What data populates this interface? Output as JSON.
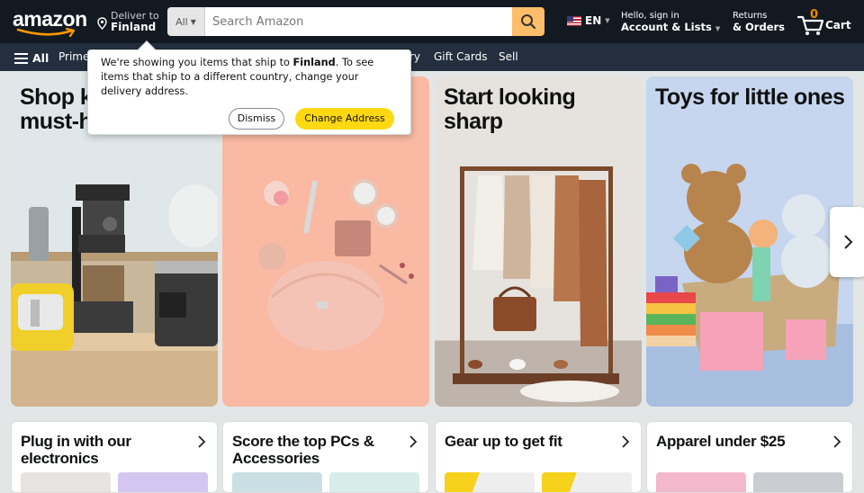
{
  "header": {
    "logo_text": "amazon",
    "deliver_line1": "Deliver to",
    "deliver_line2": "Finland",
    "search_category": "All",
    "search_placeholder": "Search Amazon",
    "language": "EN",
    "account_line1": "Hello, sign in",
    "account_line2": "Account & Lists",
    "returns_line1": "Returns",
    "returns_line2": "& Orders",
    "cart_count": "0",
    "cart_label": "Cart"
  },
  "nav": {
    "all": "All",
    "items": [
      "Prime",
      "ry",
      "Gift Cards",
      "Sell"
    ]
  },
  "popover": {
    "msg_before": "We're showing you items that ship to ",
    "msg_bold": "Finland",
    "msg_after": ". To see items that ship to a different country, change your delivery address.",
    "dismiss": "Dismiss",
    "change": "Change Address"
  },
  "cards": [
    {
      "title": "Shop kitchen must-haves"
    },
    {
      "title": ""
    },
    {
      "title": "Start looking sharp"
    },
    {
      "title": "Toys for little ones"
    }
  ],
  "tiles": [
    {
      "title": "Plug in with our electronics"
    },
    {
      "title": "Score the top PCs & Accessories"
    },
    {
      "title": "Gear up to get fit"
    },
    {
      "title": "Apparel under $25"
    }
  ],
  "colors": {
    "header_bg": "#131921",
    "nav_bg": "#232f3e",
    "search_btn": "#febd69",
    "accent": "#ffd814",
    "cart_count": "#f08804"
  }
}
